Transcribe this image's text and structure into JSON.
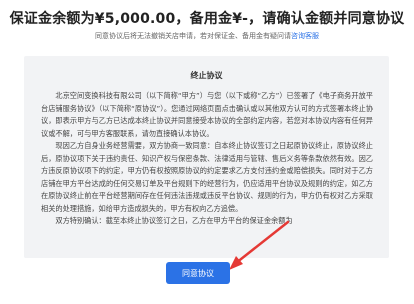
{
  "header": {
    "title": "保证金余额为¥5,000.00，备用金¥-，请确认金额并同意协议",
    "notice_text": "同意协议后将无法撤销关店申请，若对保证金、备用金有疑问请",
    "notice_link": "咨询客服"
  },
  "agreement": {
    "title": "终止协议",
    "paragraphs": [
      "北京空间变换科技有限公司（以下简称“甲方”）与您（以下或称“乙方”）已签署了《电子商务开放平台店铺服务协议》（以下简称“原协议”）。您通过网络页面点击确认或以其他双方认可的方式签署本终止协议，即表示甲方与乙方已达成本终止协议并同意接受本协议的全部约定内容，若您对本协议内容有任何异议或不解，可与甲方客服联系，请勿直接确认本协议。",
      "现因乙方自身业务经营需要，双方协商一致同意：自本终止协议签订之日起原协议终止，原协议终止后，原协议项下关于违约责任、知识产权与保密条款、法律适用与管辖、售后义务等条款依然有效。因乙方违反原协议项下的约定，甲方仍有权按照原协议的约定要求乙方支付违约金或赔偿损失。同时对于乙方店铺在甲方平台达成的任何交易订单及平台规则下的经营行为，仍应适用平台协议及规则的约定，如乙方在原协议终止前在平台经营期间存在任何违法违规或违反平台协议、规则的行为，甲方仍有权对乙方采取相关的处理措施，如给甲方造成损失的，甲方有权向乙方追偿。",
      "双方特别确认：截至本终止协议签订之日，乙方在甲方平台的保证金余额为"
    ]
  },
  "actions": {
    "agree_label": "同意协议"
  },
  "colors": {
    "accent": "#2b72e6",
    "annotation_arrow": "#e53935",
    "panel_bg": "#f2f3f5"
  }
}
